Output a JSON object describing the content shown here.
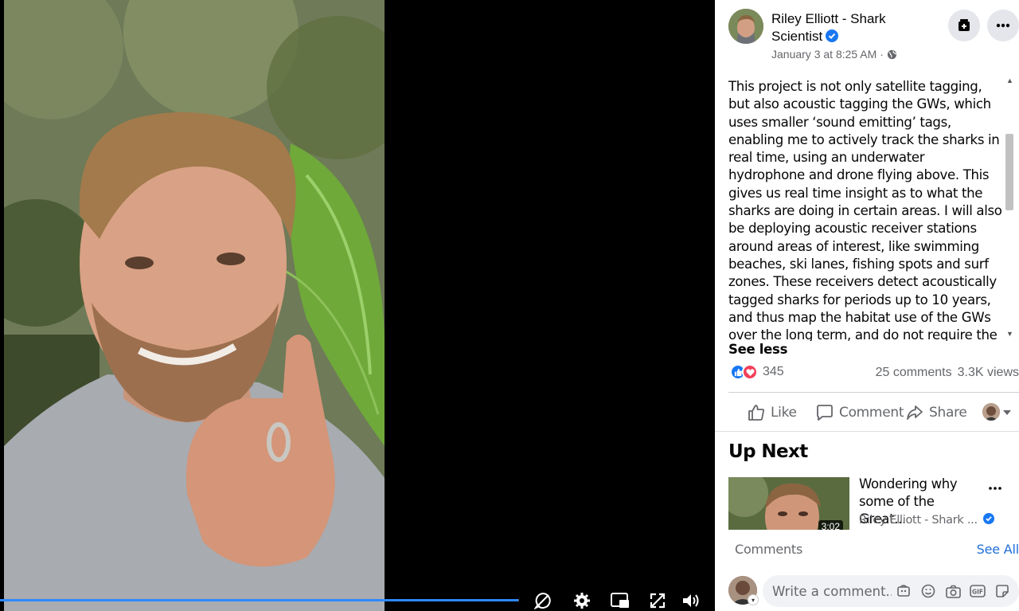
{
  "video": {
    "progress_fraction": 0.999
  },
  "post": {
    "author": "Riley Elliott - Shark Scientist",
    "timestamp": "January 3 at 8:25 AM",
    "meta_separator": "·",
    "caption": "This project is not only satellite tagging, but also acoustic tagging the GWs, which uses smaller ‘sound emitting’ tags, enabling me to actively track the sharks in real time, using an underwater hydrophone and drone flying above. This gives us real time insight as to what the sharks are doing in certain areas. I will also be deploying acoustic receiver stations around areas of interest, like swimming beaches, ski lanes, fishing spots and surf zones. These receivers detect acoustically tagged sharks for periods up to 10 years, and thus map the habitat use of the GWs over the long term, and do not require the sharks to break the waters surface, like satellite tags do.",
    "see_less": "See less",
    "reaction_count": "345",
    "comments_count": "25 comments",
    "views_count": "3.3K views"
  },
  "actions": {
    "like": "Like",
    "comment": "Comment",
    "share": "Share"
  },
  "up_next": {
    "heading": "Up Next",
    "title": "Wondering why some of the Great...",
    "channel": "Riley Elliott - Shark ...",
    "duration": "3:02"
  },
  "comments": {
    "label": "Comments",
    "see_all": "See All",
    "placeholder": "Write a comment..."
  },
  "colors": {
    "accent": "#2d88ff",
    "link": "#216fdb",
    "verified": "#1877f2",
    "like": "#1877f2",
    "love": "#f33e58",
    "muted_text": "#65676b"
  }
}
